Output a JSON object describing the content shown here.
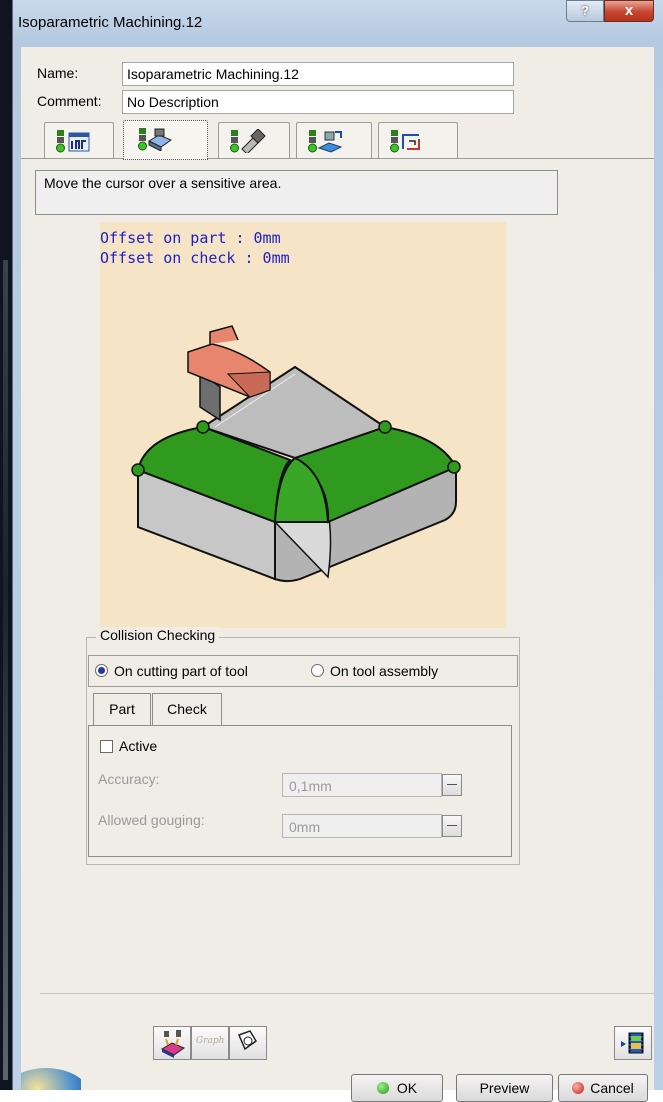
{
  "window": {
    "title": "Isoparametric Machining.12",
    "help_label": "?",
    "close_label": "x"
  },
  "form": {
    "name_label": "Name:",
    "name_value": "Isoparametric Machining.12",
    "comment_label": "Comment:",
    "comment_value": "No Description"
  },
  "tabs": [
    {
      "icon": "strategy-tab-icon",
      "selected": false
    },
    {
      "icon": "geometry-tab-icon",
      "selected": true
    },
    {
      "icon": "tool-tab-icon",
      "selected": false
    },
    {
      "icon": "feeds-speeds-tab-icon",
      "selected": false
    },
    {
      "icon": "macros-tab-icon",
      "selected": false
    }
  ],
  "status_text": "Move the cursor over a sensitive area.",
  "diagram": {
    "offset_part": "Offset on part : 0mm",
    "offset_check": "Offset on check : 0mm"
  },
  "collision": {
    "title": "Collision Checking",
    "option_1": "On cutting part of tool",
    "option_2": "On tool assembly",
    "selected": "On cutting part of tool",
    "subtab_part": "Part",
    "subtab_check": "Check",
    "active_label": "Active",
    "active_checked": false,
    "accuracy_label": "Accuracy:",
    "accuracy_value": "0,1mm",
    "gouging_label": "Allowed gouging:",
    "gouging_value": "0mm"
  },
  "buttons": {
    "ok": "OK",
    "preview": "Preview",
    "cancel": "Cancel",
    "graph_label": "Graph"
  },
  "colors": {
    "diagram_bg": "#f6e4c7",
    "surface_green": "#2f9a1e",
    "offset_text": "#1d1ec8",
    "tool_salmon": "#e8856e"
  }
}
